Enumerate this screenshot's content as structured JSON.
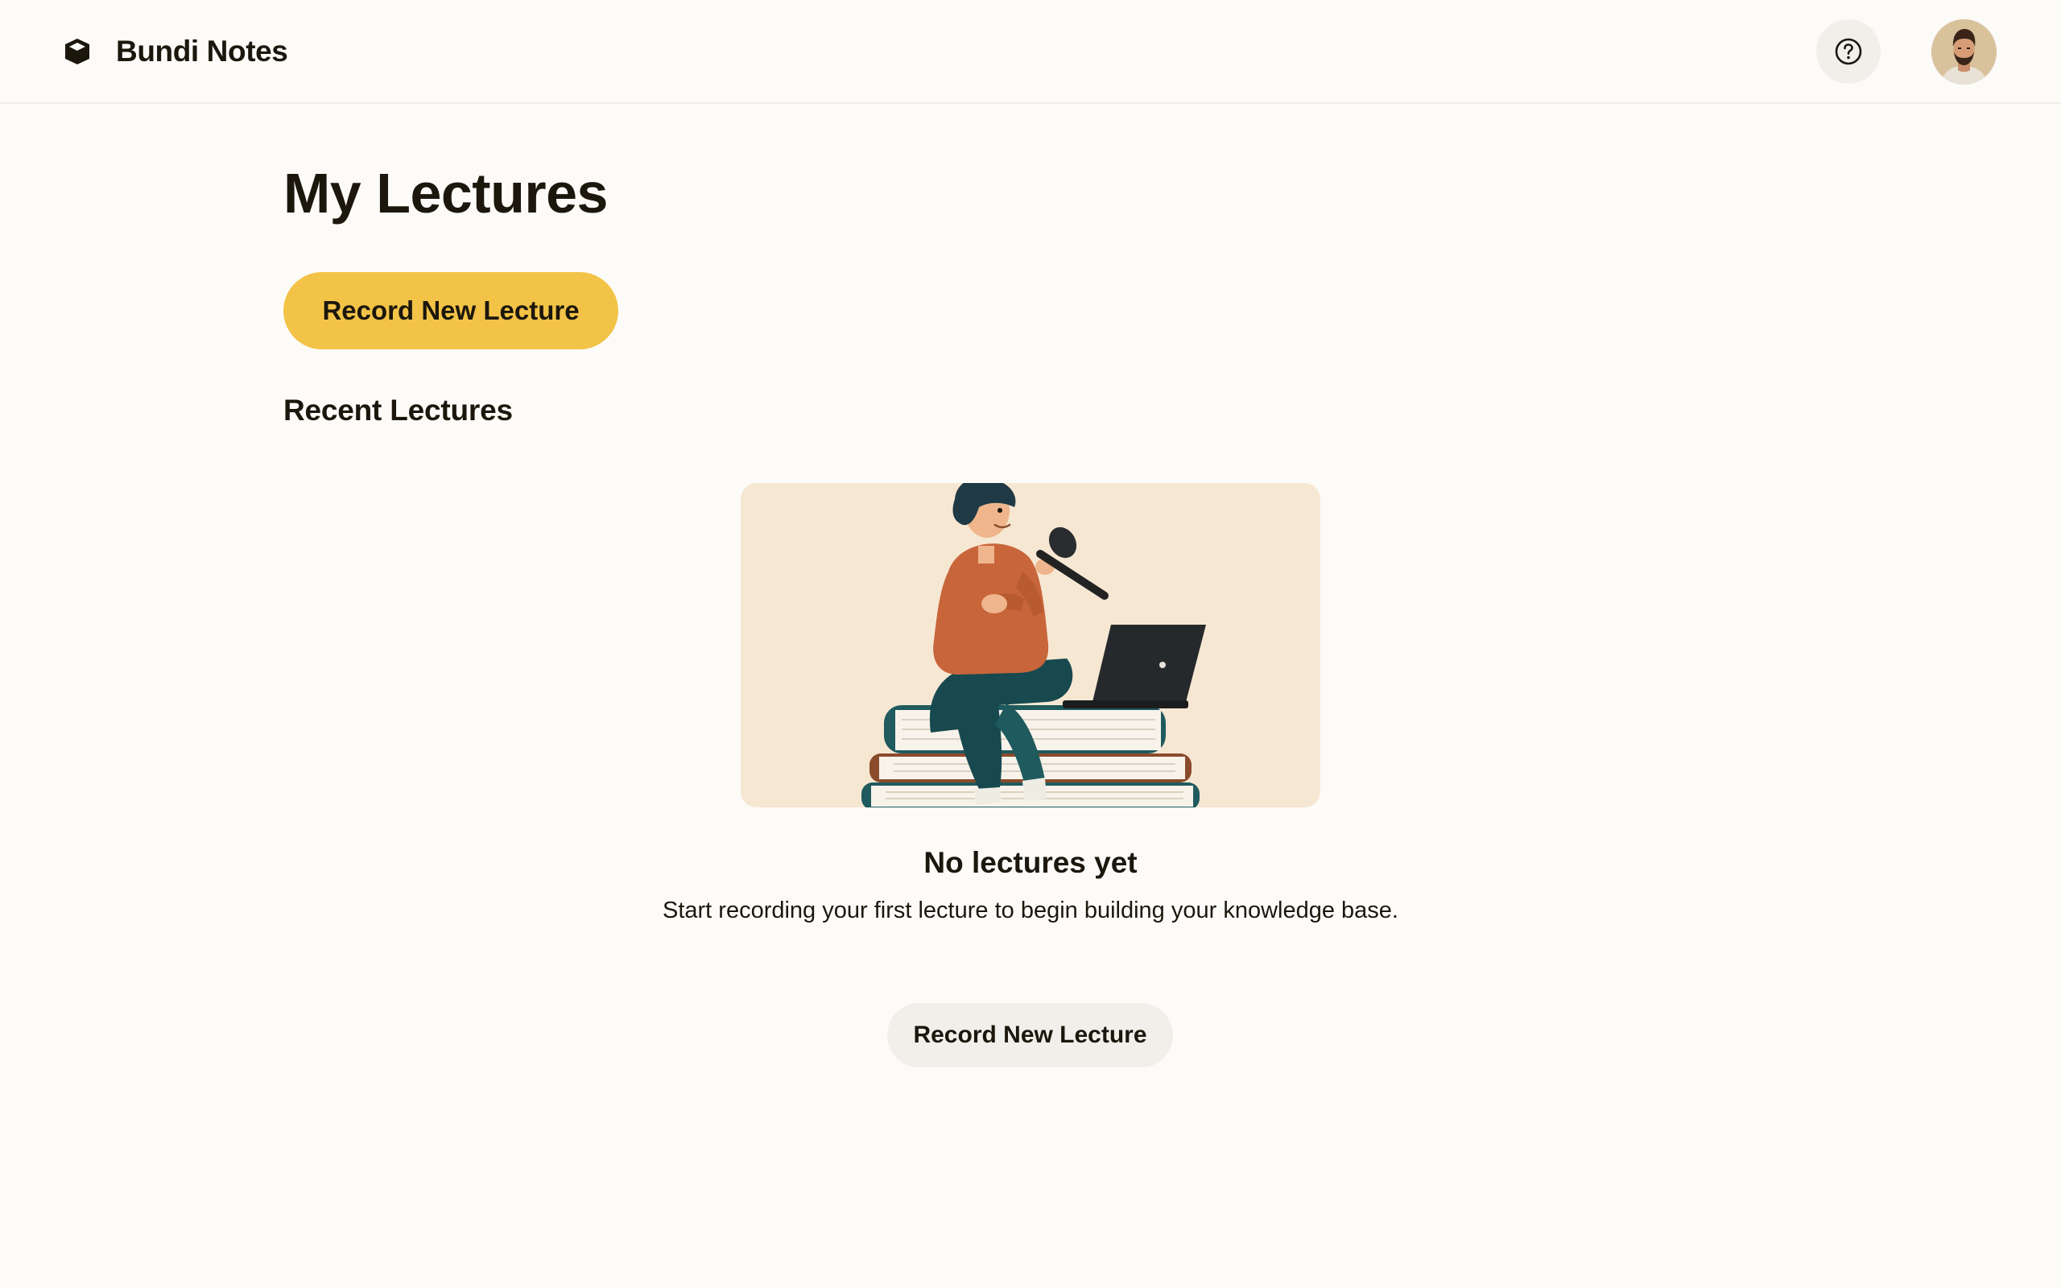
{
  "app": {
    "name": "Bundi Notes",
    "icon": "cube-icon"
  },
  "header": {
    "help_icon": "question-circle-icon",
    "avatar": "user-avatar"
  },
  "main": {
    "title": "My Lectures",
    "record_button_label": "Record New Lecture",
    "section_title": "Recent Lectures",
    "empty_state": {
      "illustration": "person-with-microphone-on-books-illustration",
      "title": "No lectures yet",
      "description": "Start recording your first lecture to begin building your knowledge base.",
      "button_label": "Record New Lecture"
    }
  },
  "colors": {
    "background": "#fcfbf8",
    "accent": "#f2c347",
    "secondary_button": "#f1efe9",
    "text": "#1c170d",
    "illustration_bg": "#f6e7d3"
  }
}
